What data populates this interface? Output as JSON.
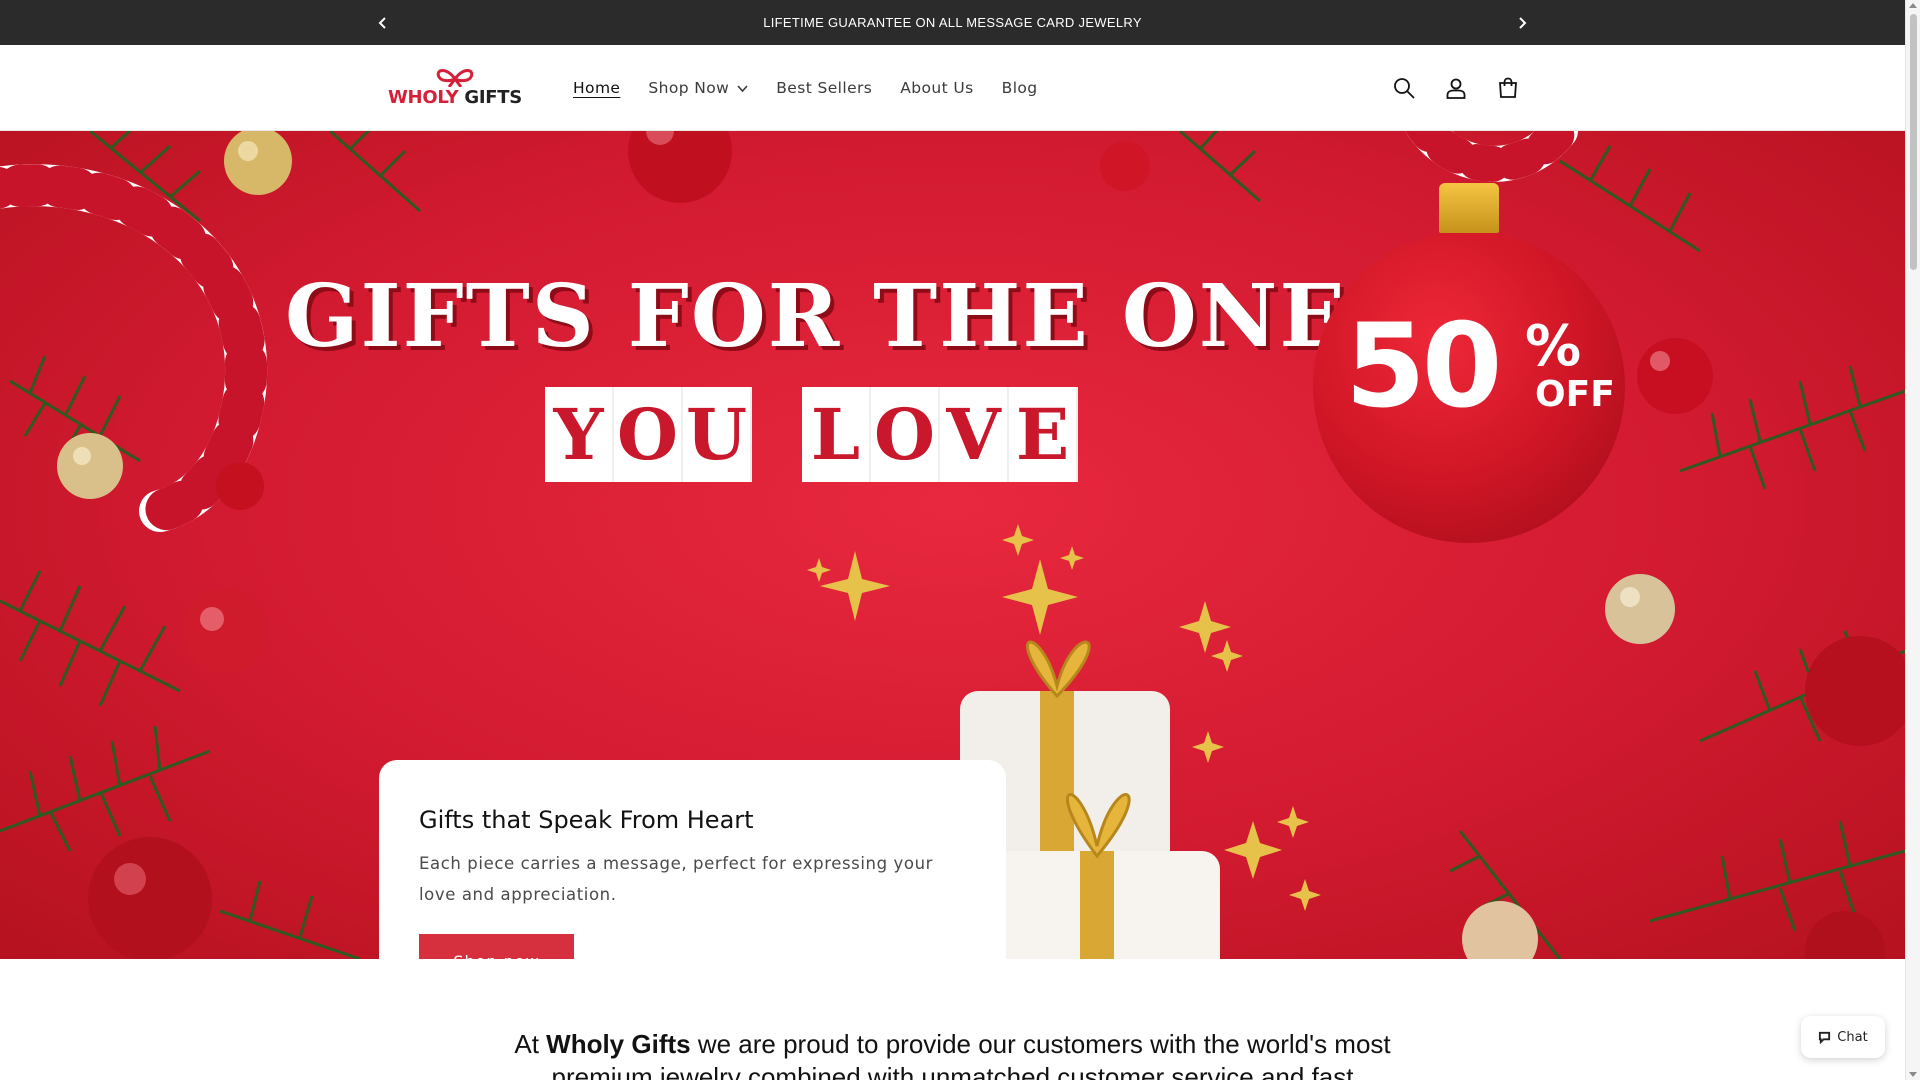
{
  "announcement": {
    "text": "LIFETIME GUARANTEE ON ALL MESSAGE CARD JEWELRY"
  },
  "header": {
    "logo": {
      "word1": "WHOLY",
      "word2": "GIFTS"
    },
    "nav": [
      {
        "label": "Home",
        "active": true
      },
      {
        "label": "Shop Now",
        "dropdown": true
      },
      {
        "label": "Best Sellers"
      },
      {
        "label": "About Us"
      },
      {
        "label": "Blog"
      }
    ],
    "icons": [
      "search-icon",
      "account-icon",
      "cart-icon"
    ]
  },
  "hero": {
    "headline_line1": "GIFTS FOR THE ONES",
    "headline_line2_words": [
      "YOU",
      "LOVE"
    ],
    "badge": {
      "number": "50",
      "symbol": "%",
      "suffix": "OFF"
    },
    "colors": {
      "background": "#d21a30",
      "gold": "#e0b43a",
      "green": "#2f5a1f"
    }
  },
  "card": {
    "title": "Gifts that Speak From Heart",
    "body": "Each piece carries a message, perfect for expressing your love and appreciation.",
    "button": "Shop now",
    "button_color": "#d6303f"
  },
  "intro": {
    "prefix": "At ",
    "brand": "Wholy Gifts",
    "line1_rest": " we are proud to provide our customers with the world's most",
    "line2": "premium jewelry combined with unmatched customer service and fast"
  },
  "chat": {
    "label": "Chat"
  }
}
